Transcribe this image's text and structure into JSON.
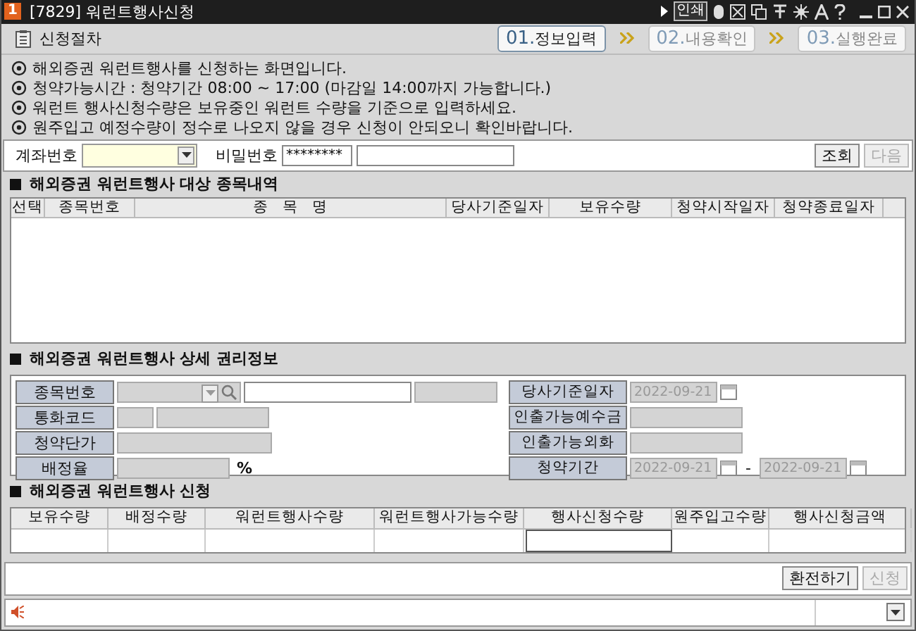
{
  "window": {
    "badge": "1",
    "title": "[7829] 워런트행사신청",
    "print_label": "인쇄"
  },
  "header": {
    "title": "신청절차",
    "steps": [
      {
        "number": "01.",
        "label": "정보입력",
        "selected": true
      },
      {
        "number": "02.",
        "label": "내용확인",
        "selected": false
      },
      {
        "number": "03.",
        "label": "실행완료",
        "selected": false
      }
    ]
  },
  "notices": [
    "해외증권 워런트행사를 신청하는 화면입니다.",
    "청약가능시간 : 청약기간 08:00 ~ 17:00 (마감일 14:00까지 가능합니다.)",
    "워런트 행사신청수량은 보유중인 워런트 수량을 기준으로 입력하세요.",
    "원주입고 예정수량이 정수로 나오지 않을 경우 신청이 안되오니 확인바랍니다."
  ],
  "account": {
    "account_label": "계좌번호",
    "password_label": "비밀번호",
    "password_value": "********",
    "buttons": [
      {
        "label": "조회",
        "disabled": false
      },
      {
        "label": "다음",
        "disabled": true
      }
    ]
  },
  "list_section": {
    "title": "해외증권 워런트행사 대상 종목내역",
    "columns": [
      "선택",
      "종목번호",
      "종   목   명",
      "당사기준일자",
      "보유수량",
      "청약시작일자",
      "청약종료일자"
    ]
  },
  "detail_section": {
    "title": "해외증권 워런트행사 상세 권리정보",
    "left": [
      {
        "kind": "code",
        "label": "종목번호"
      },
      {
        "kind": "currency",
        "label": "통화코드"
      },
      {
        "kind": "price",
        "label": "청약단가"
      },
      {
        "kind": "rate",
        "label": "배정율",
        "suffix": "%"
      }
    ],
    "right": [
      {
        "kind": "date",
        "label": "당사기준일자",
        "value": "2022-09-21"
      },
      {
        "kind": "amount",
        "label": "인출가능예수금"
      },
      {
        "kind": "amount",
        "label": "인출가능외화"
      },
      {
        "kind": "range",
        "label": "청약기간",
        "value": "2022-09-21",
        "separator": "-",
        "value_to": "2022-09-21"
      }
    ]
  },
  "apply_section": {
    "title": "해외증권 워런트행사 신청",
    "columns": [
      "보유수량",
      "배정수량",
      "워런트행사수량",
      "워런트행사가능수량",
      "행사신청수량",
      "원주입고수량",
      "행사신청금액"
    ]
  },
  "actions": [
    {
      "label": "환전하기",
      "disabled": false
    },
    {
      "label": "신청",
      "disabled": true
    }
  ]
}
